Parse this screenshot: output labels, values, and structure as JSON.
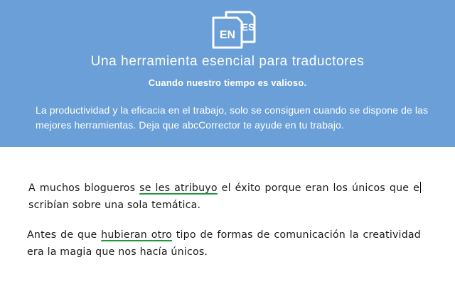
{
  "hero": {
    "logo": {
      "icon": "en-es-translate-icon",
      "text_front": "EN",
      "text_back": "ES"
    },
    "headline": "Una herramienta esencial para traductores",
    "subheadline": "Cuando nuestro tiempo es valioso.",
    "intro": "La productividad y la eficacia en el trabajo, solo se consiguen cuando se dispone de las mejores herramientas. Deja que abcCorrector te ayude en tu trabajo."
  },
  "document": {
    "p1": {
      "before": "A muchos blogueros ",
      "flagged": "se les atribuyo",
      "after_flag": " el éxito porque eran los únicos que e",
      "after_caret": "scribían sobre una sola temática."
    },
    "p2": {
      "before": "Antes de que ",
      "flagged": "hubieran otro",
      "after": " tipo de formas de comunicación la creatividad era la magia que nos hacía únicos."
    }
  },
  "colors": {
    "hero_background": "#6a9fd8",
    "flag_underline": "#1f9a3a"
  }
}
